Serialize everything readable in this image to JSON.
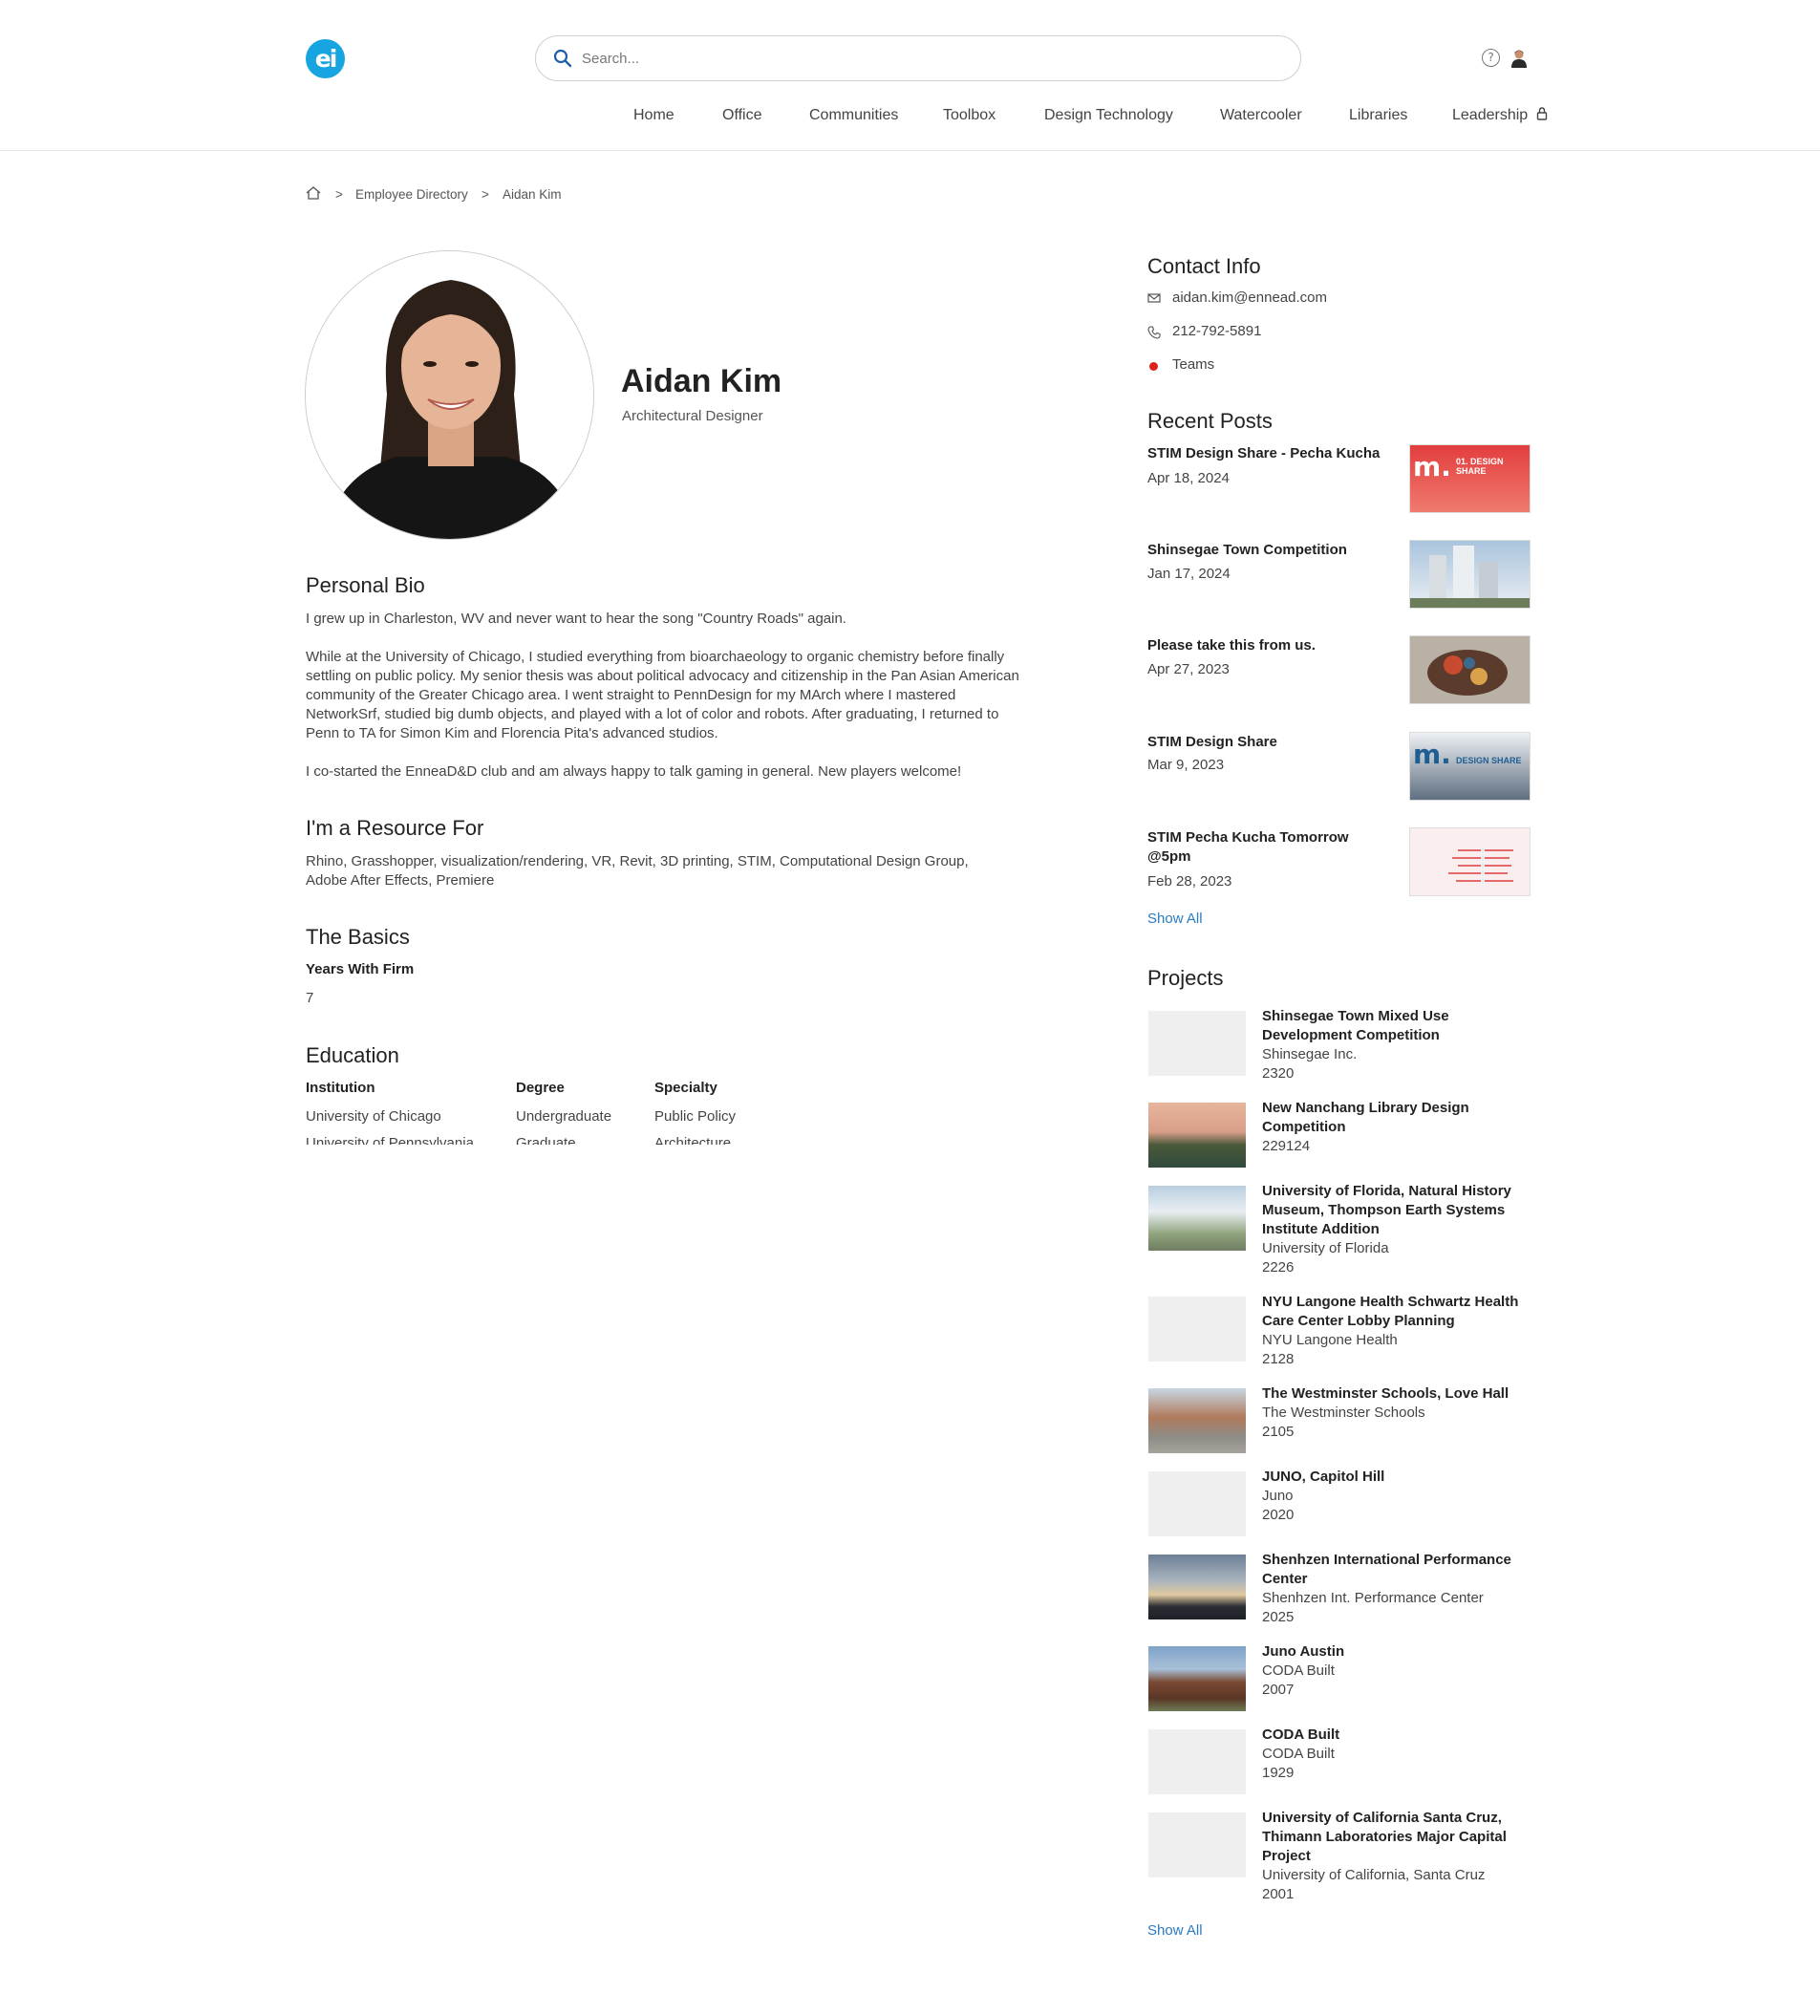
{
  "header": {
    "logo_text": "ei",
    "search_placeholder": "Search...",
    "nav": [
      "Home",
      "Office",
      "Communities",
      "Toolbox",
      "Design Technology",
      "Watercooler",
      "Libraries",
      "Leadership"
    ]
  },
  "breadcrumb": {
    "sep1": ">",
    "directory": "Employee Directory",
    "sep2": ">",
    "current": "Aidan Kim"
  },
  "profile": {
    "name": "Aidan Kim",
    "title": "Architectural Designer"
  },
  "bio": {
    "heading": "Personal Bio",
    "p1": "I grew up in Charleston, WV and never want to hear the song \"Country Roads\" again.",
    "p2": "While at the University of Chicago, I studied everything from bioarchaeology to organic chemistry before finally settling on public policy. My senior thesis was about political advocacy and citizenship in the Pan Asian American community of the Greater Chicago area. I went straight to PennDesign for my MArch where I mastered NetworkSrf, studied big dumb objects, and played with a lot of color and robots. After graduating, I returned to Penn to TA for Simon Kim and Florencia Pita's advanced studios.",
    "p3": "I co-started the EnneaD&D club and am always happy to talk gaming in general. New players welcome!"
  },
  "resource": {
    "heading": "I'm a Resource For",
    "text": "Rhino, Grasshopper, visualization/rendering, VR, Revit, 3D printing, STIM, Computational Design Group, Adobe After Effects, Premiere"
  },
  "basics": {
    "heading": "The Basics",
    "years_label": "Years With Firm",
    "years_value": "7"
  },
  "education": {
    "heading": "Education",
    "col_institution": "Institution",
    "col_degree": "Degree",
    "col_specialty": "Specialty",
    "row1": {
      "institution": "University of Chicago",
      "degree": "Undergraduate",
      "specialty": "Public Policy"
    },
    "row2": {
      "institution": "University of Pennsylvania",
      "degree": "Graduate",
      "specialty": "Architecture"
    }
  },
  "contact": {
    "heading": "Contact Info",
    "email": "aidan.kim@ennead.com",
    "phone": "212-792-5891",
    "teams": "Teams",
    "teams_status_color": "#e0201b"
  },
  "posts": {
    "heading": "Recent Posts",
    "items": [
      {
        "title": "STIM Design Share - Pecha Kucha",
        "date": "Apr 18, 2024",
        "thumb_text": "01. DESIGN SHARE"
      },
      {
        "title": "Shinsegae Town Competition",
        "date": "Jan 17, 2024"
      },
      {
        "title": "Please take this from us.",
        "date": "Apr 27, 2023"
      },
      {
        "title": "STIM Design Share",
        "date": "Mar 9, 2023",
        "thumb_text": "DESIGN SHARE"
      },
      {
        "title": "STIM Pecha Kucha Tomorrow @5pm",
        "date": "Feb 28, 2023"
      }
    ],
    "show_all": "Show All"
  },
  "projects": {
    "heading": "Projects",
    "items": [
      {
        "title": "Shinsegae Town Mixed Use Development Competition",
        "client": "Shinsegae Inc.",
        "number": "2320"
      },
      {
        "title": "New Nanchang Library Design Competition",
        "client": "",
        "number": "229124"
      },
      {
        "title": "University of Florida, Natural History Museum, Thompson Earth Systems Institute Addition",
        "client": "University of Florida",
        "number": "2226"
      },
      {
        "title": "NYU Langone Health Schwartz Health Care Center Lobby Planning",
        "client": "NYU Langone Health",
        "number": "2128"
      },
      {
        "title": "The Westminster Schools, Love Hall",
        "client": "The Westminster Schools",
        "number": "2105"
      },
      {
        "title": "JUNO, Capitol Hill",
        "client": "Juno",
        "number": "2020"
      },
      {
        "title": "Shenhzen International Performance Center",
        "client": "Shenhzen Int. Performance Center",
        "number": "2025"
      },
      {
        "title": "Juno Austin",
        "client": "CODA Built",
        "number": "2007"
      },
      {
        "title": "CODA Built",
        "client": "CODA Built",
        "number": "1929"
      },
      {
        "title": "University of California Santa Cruz, Thimann Laboratories Major Capital Project",
        "client": "University of California, Santa Cruz",
        "number": "2001"
      }
    ],
    "show_all": "Show All"
  },
  "colors": {
    "accent": "#16a5e0",
    "link": "#2b7bc0"
  }
}
